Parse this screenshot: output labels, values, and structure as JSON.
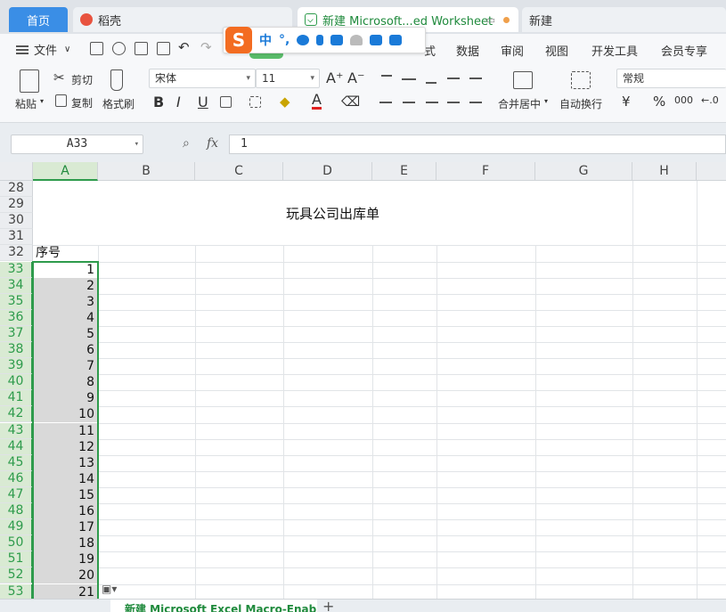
{
  "tabs": {
    "home": "首页",
    "shell": "稻壳",
    "doc": "新建 Microsoft...ed Worksheet",
    "new": "新建"
  },
  "menu": {
    "file": "文件",
    "items": [
      "式",
      "数据",
      "审阅",
      "视图",
      "开发工具",
      "会员专享"
    ]
  },
  "ime": {
    "logo": "S",
    "mode": "中",
    "punct": "°,"
  },
  "ribbon": {
    "cut": "剪切",
    "paste": "粘贴",
    "copy": "复制",
    "format_painter": "格式刷",
    "font_name": "宋体",
    "font_size": "11",
    "merge_center": "合并居中",
    "auto_wrap": "自动换行",
    "number_format": "常规",
    "currency": "¥",
    "percent": "%",
    "thousands": "000"
  },
  "formula_bar": {
    "name_box": "A33",
    "fx": "fx",
    "value": "1"
  },
  "columns": [
    "A",
    "B",
    "C",
    "D",
    "E",
    "F",
    "G",
    "H"
  ],
  "rows": [
    "28",
    "29",
    "30",
    "31",
    "32",
    "33",
    "34",
    "35",
    "36",
    "37",
    "38",
    "39",
    "40",
    "41",
    "42",
    "43",
    "44",
    "45",
    "46",
    "47",
    "48",
    "49",
    "50",
    "51",
    "52",
    "53"
  ],
  "sheet": {
    "title": "玩具公司出库单",
    "header_a32": "序号",
    "serials": [
      "1",
      "2",
      "3",
      "4",
      "5",
      "6",
      "7",
      "8",
      "9",
      "10",
      "11",
      "12",
      "13",
      "14",
      "15",
      "16",
      "17",
      "18",
      "19",
      "20",
      "21"
    ]
  },
  "sheet_tab": "新建 Microsoft Excel Macro-Enable",
  "colors": {
    "accent_green": "#2e9b4c",
    "home_tab_blue": "#3a8ee6",
    "ime_orange": "#f36c21"
  }
}
